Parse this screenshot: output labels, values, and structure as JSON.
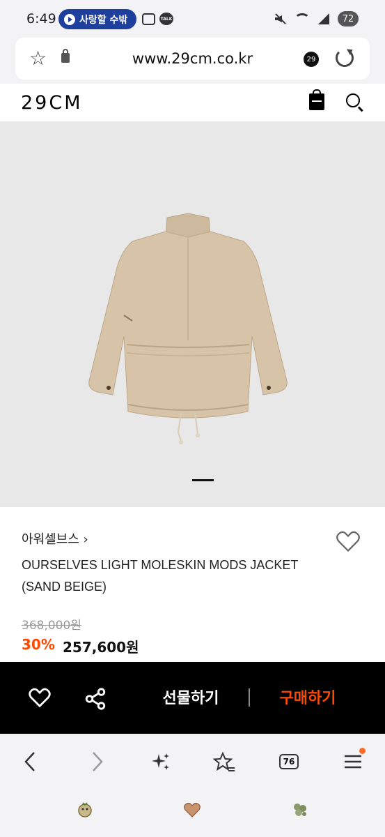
{
  "status_bar": {
    "time": "6:49",
    "media_pill": "사랑할 수밖",
    "talk_badge": "TALK",
    "battery": "72"
  },
  "browser": {
    "url": "www.29cm.co.kr",
    "site_badge": "29",
    "tab_count": "76"
  },
  "site": {
    "logo": "29CM"
  },
  "product": {
    "brand": "아워셀브스",
    "brand_chevron": "›",
    "name": "OURSELVES LIGHT MOLESKIN MODS JACKET (SAND BEIGE)",
    "original_price": "368,000원",
    "discount": "30%",
    "price": "257,600원",
    "image_count": 1
  },
  "actions": {
    "gift_label": "선물하기",
    "buy_label": "구매하기"
  },
  "colors": {
    "accent": "#ff4800",
    "jacket": "#d6c3a8",
    "action_bar_bg": "#000000"
  },
  "icons": {
    "status": [
      "media-play-icon",
      "screen-record-icon",
      "talk-icon",
      "mute-icon",
      "wifi-icon",
      "signal-icon"
    ],
    "url_bar": [
      "bookmark-star-icon",
      "lock-icon",
      "reload-icon"
    ],
    "header": [
      "shopping-bag-icon",
      "search-icon"
    ],
    "actions": [
      "heart-icon",
      "share-icon"
    ],
    "browser_nav": [
      "back-icon",
      "forward-icon",
      "sparkle-icon",
      "favorites-icon",
      "tabs-icon",
      "menu-icon"
    ]
  }
}
